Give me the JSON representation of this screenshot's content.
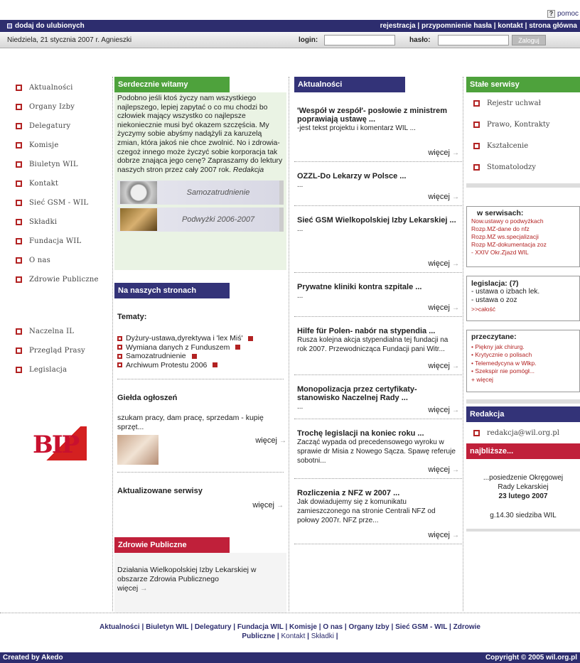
{
  "help": {
    "icon_glyph": "?",
    "label": "pomoc"
  },
  "topnav": {
    "favorite": "dodaj do ulubionych",
    "links": [
      "rejestracja",
      "przypomnienie hasła",
      "kontakt",
      "strona główna"
    ],
    "separator": " | "
  },
  "loginbar": {
    "date_text": "Niedziela, 21 stycznia 2007 r. Agnieszki",
    "login_label": "login:",
    "password_label": "hasło:",
    "login_value": "",
    "password_value": "",
    "submit_label": "Zaloguj"
  },
  "leftnav": {
    "items": [
      "Aktualności",
      "Organy Izby",
      "Delegatury",
      "Komisje",
      "Biuletyn WIL",
      "Kontakt",
      "Sieć GSM - WIL",
      "Składki",
      "Fundacja WIL",
      "O nas",
      "Zdrowie Publiczne"
    ],
    "items2": [
      "Naczelna IL",
      "Przegląd Prasy",
      "Legislacja"
    ],
    "logo_text": "BIP"
  },
  "welcome": {
    "header": "Serdecznie witamy",
    "text": "Podobno jeśli ktoś życzy nam wszystkiego najlepszego, lepiej zapytać o co mu chodzi bo człowiek mający wszystko co najlepsze niekoniecznie musi być okazem szczęścia. My życzymy sobie abyśmy nadążyli za karuzelą zmian, która jakoś nie chce zwolnić. No i zdrowia- czegoż innego może życzyć sobie korporacja tak dobrze znająca jego cenę? Zapraszamy do lektury naszych stron przez cały 2007 rok.",
    "signature": "Redakcja",
    "banners": [
      "Samozatrudnienie",
      "Podwyżki 2006-2007"
    ]
  },
  "our_pages": {
    "header": "Na naszych stronach",
    "topics_label": "Tematy:",
    "topics": [
      "Dyżury-ustawa,dyrektywa i 'lex Miś'",
      "Wymiana danych z Funduszem",
      "Samozatrudnienie",
      "Archiwum Protestu 2006"
    ],
    "ads_title": "Giełda ogłoszeń",
    "ads_text": "szukam pracy, dam pracę, sprzedam - kupię sprzęt...",
    "more": "więcej",
    "updated_title": "Aktualizowane serwisy"
  },
  "public_health": {
    "header": "Zdrowie Publiczne",
    "text": "Działania Wielkopolskiej Izby Lekarskiej w obszarze Zdrowia Publicznego",
    "more": "więcej"
  },
  "news": {
    "header": "Aktualności",
    "more": "więcej",
    "items": [
      {
        "title": "'Wespół w zespół'- posłowie z ministrem poprawiają ustawę ...",
        "text": "-jest tekst projektu i komentarz WIL ..."
      },
      {
        "title": "OZZL-Do Lekarzy w Polsce ...",
        "text": "..."
      },
      {
        "title": "Sieć GSM Wielkopolskiej Izby Lekarskiej ...",
        "text": "..."
      },
      {
        "title": "Prywatne kliniki kontra szpitale ...",
        "text": "..."
      },
      {
        "title": "Hilfe für Polen- nabór na stypendia ...",
        "text": "Rusza kolejna akcja stypendialna tej fundacji na rok 2007. Przewodnicząca Fundacji pani Witr..."
      },
      {
        "title": "Monopolizacja przez certyfikaty- stanowisko Naczelnej Rady ...",
        "text": "..."
      },
      {
        "title": "Trochę legislacji na koniec roku ...",
        "text": "Zacząć wypada od precedensowego wyroku w sprawie dr Misia z Nowego Sącza. Spawę referuje sobotni..."
      },
      {
        "title": "Rozliczenia z NFZ w 2007 ...",
        "text": "Jak dowiadujemy się z komunikatu zamieszczonego na stronie Centrali NFZ od połowy 2007r. NFZ prze..."
      }
    ]
  },
  "services": {
    "header": "Stałe serwisy",
    "items": [
      "Rejestr uchwał",
      "Prawo, Kontrakty",
      "Kształcenie",
      "Stomatolodzy"
    ],
    "in_service_title": "w serwisach:",
    "in_service_items": [
      "Now.ustawy o podwyżkach",
      "Rozp.MZ-dane do nfz",
      "Rozp.MZ ws.specjalizacji",
      "Rozp MZ-dokumentacja zoz",
      "- XXIV Okr.Zjazd WIL"
    ],
    "legis_title": "legislacja: (7)",
    "legis_items": [
      "- ustawa o izbach lek.",
      "- ustawa o zoz"
    ],
    "legis_more": ">>całość",
    "read_title": "przeczytane:",
    "read_items": [
      "• Piękny jak chirurg.",
      "• Krytycznie o polisach",
      "• Telemedycyna w Wlkp.",
      "• Szekspir nie pomógł..."
    ],
    "read_more": "+ więcej"
  },
  "editorial": {
    "header": "Redakcja",
    "email": "redakcja@wil.org.pl"
  },
  "upcoming": {
    "header": "najbliższe...",
    "line1": "...posiedzenie Okręgowej",
    "line2": "Rady Lekarskiej",
    "date": "23 lutego 2007",
    "time": "g.14.30 siedziba WIL"
  },
  "footer": {
    "line1": [
      "Aktualności",
      "Biuletyn WIL",
      "Delegatury",
      "Fundacja WIL",
      "Komisje",
      "O nas",
      "Organy Izby",
      "Sieć GSM - WIL",
      "Zdrowie"
    ],
    "line2_bold": "Publiczne",
    "line2_rest": [
      "Kontakt",
      "Składki"
    ],
    "credits": "Created by Akedo",
    "copyright": "Copyright © 2005 wil.org.pl"
  }
}
